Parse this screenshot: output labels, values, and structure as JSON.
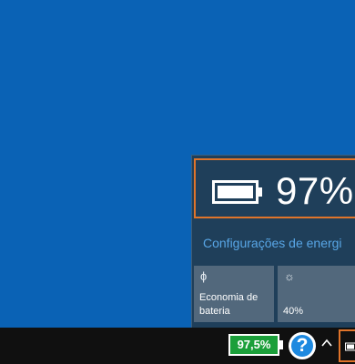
{
  "flyout": {
    "percent": "97%",
    "battery_level": 0.97,
    "settings_link": "Configurações de energi",
    "tiles": [
      {
        "icon": "leaf-icon",
        "glyph": "ɸ",
        "label_line1": "Economia de",
        "label_line2": "bateria"
      },
      {
        "icon": "brightness-icon",
        "glyph": "☼",
        "label_line1": "",
        "label_line2": "40%"
      }
    ]
  },
  "taskbar": {
    "battery_badge": "97,5%",
    "help_glyph": "?"
  },
  "colors": {
    "desktop": "#0a62b5",
    "flyout_bg": "#1f3f5a",
    "highlight": "#e0742a",
    "link": "#58a6e6",
    "tile_bg": "#52687c",
    "badge_green": "#1b9f3a",
    "taskbar": "#101010"
  }
}
